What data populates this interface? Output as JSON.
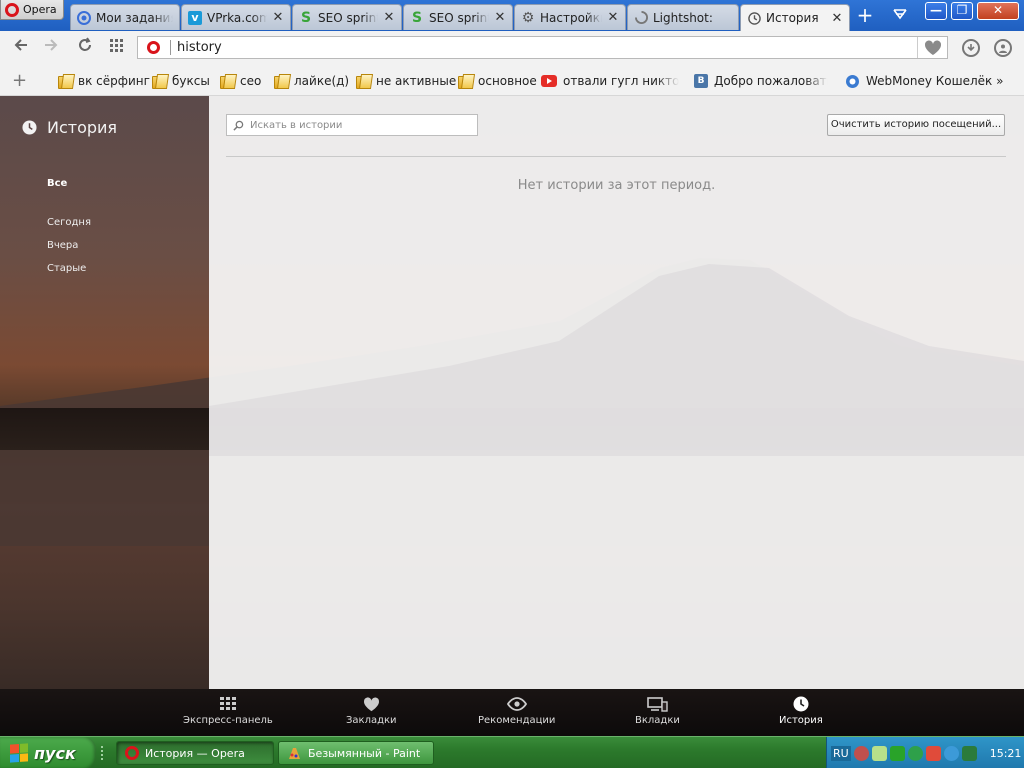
{
  "browser": {
    "menu_label": "Opera",
    "tabs": [
      {
        "title": "Мои задания",
        "icon": "target-icon",
        "color": "#3a6fd8"
      },
      {
        "title": "VPrka.com - ",
        "icon": "v-icon",
        "color": "#1a9ad8"
      },
      {
        "title": "SEO sprint",
        "icon": "seo-sprint-icon",
        "color": "#39a539"
      },
      {
        "title": "SEO sprint",
        "icon": "seo-sprint-icon",
        "color": "#39a539"
      },
      {
        "title": "Настройки",
        "icon": "gear-icon",
        "color": "#555555"
      },
      {
        "title": "Lightshot: ",
        "icon": "loading-icon",
        "color": "#777777"
      },
      {
        "title": "История",
        "icon": "clock-icon",
        "color": "#555555",
        "active": true
      }
    ],
    "url": "history"
  },
  "bookmarks": [
    {
      "label": "вк сёрфинг",
      "type": "folder"
    },
    {
      "label": "буксы",
      "type": "folder"
    },
    {
      "label": "сео",
      "type": "folder"
    },
    {
      "label": "лайке(д)",
      "type": "folder"
    },
    {
      "label": "не активные",
      "type": "folder"
    },
    {
      "label": "основное",
      "type": "folder"
    },
    {
      "label": "отвали гугл никтошна",
      "type": "youtube"
    },
    {
      "label": "Добро пожаловать | ВК",
      "type": "vk"
    },
    {
      "label": "WebMoney Кошелёк »",
      "type": "webmoney"
    }
  ],
  "sidebar": {
    "title": "История",
    "items": [
      {
        "label": "Все",
        "selected": true
      },
      {
        "label": "Сегодня"
      },
      {
        "label": "Вчера"
      },
      {
        "label": "Старые"
      }
    ]
  },
  "main": {
    "search_placeholder": "Искать в истории",
    "clear_button": "Очистить историю посещений...",
    "empty_message": "Нет истории за этот период."
  },
  "dialbar": [
    {
      "label": "Экспресс-панель",
      "icon": "grid-icon"
    },
    {
      "label": "Закладки",
      "icon": "heart-icon"
    },
    {
      "label": "Рекомендации",
      "icon": "eye-icon"
    },
    {
      "label": "Вкладки",
      "icon": "devices-icon"
    },
    {
      "label": "История",
      "icon": "clock-icon",
      "active": true
    }
  ],
  "taskbar": {
    "start_label": "пуск",
    "tasks": [
      {
        "title": "История — Opera",
        "active": true
      },
      {
        "title": "Безымянный - Paint",
        "active": false
      }
    ],
    "lang": "RU",
    "time": "15:21"
  }
}
